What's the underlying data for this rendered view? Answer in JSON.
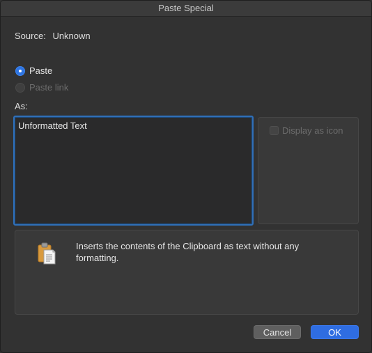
{
  "window": {
    "title": "Paste Special"
  },
  "source": {
    "label": "Source:",
    "value": "Unknown"
  },
  "paste_options": [
    {
      "label": "Paste",
      "selected": true,
      "enabled": true
    },
    {
      "label": "Paste link",
      "selected": false,
      "enabled": false
    }
  ],
  "as": {
    "label": "As:",
    "items": [
      "Unformatted Text"
    ],
    "selected": "Unformatted Text"
  },
  "display_as_icon": {
    "label": "Display as icon",
    "checked": false,
    "enabled": false
  },
  "result": {
    "icon": "clipboard-icon",
    "description": "Inserts the contents of the Clipboard as text without any formatting."
  },
  "buttons": {
    "cancel": "Cancel",
    "ok": "OK"
  },
  "colors": {
    "accent": "#2f6de1",
    "background": "#323232",
    "focus_ring": "#2f6fb8"
  }
}
